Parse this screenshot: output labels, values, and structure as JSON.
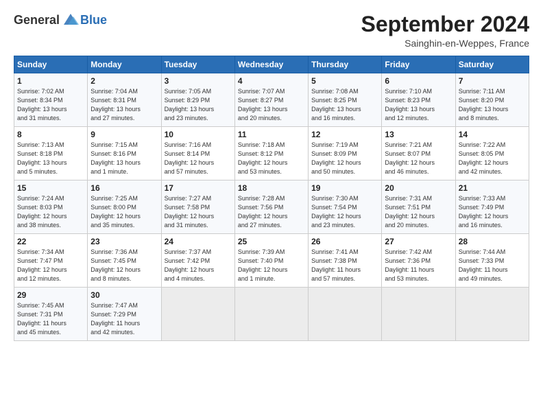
{
  "header": {
    "logo_general": "General",
    "logo_blue": "Blue",
    "month_title": "September 2024",
    "location": "Sainghin-en-Weppes, France"
  },
  "columns": [
    "Sunday",
    "Monday",
    "Tuesday",
    "Wednesday",
    "Thursday",
    "Friday",
    "Saturday"
  ],
  "weeks": [
    [
      {
        "day": "1",
        "info": "Sunrise: 7:02 AM\nSunset: 8:34 PM\nDaylight: 13 hours\nand 31 minutes."
      },
      {
        "day": "2",
        "info": "Sunrise: 7:04 AM\nSunset: 8:31 PM\nDaylight: 13 hours\nand 27 minutes."
      },
      {
        "day": "3",
        "info": "Sunrise: 7:05 AM\nSunset: 8:29 PM\nDaylight: 13 hours\nand 23 minutes."
      },
      {
        "day": "4",
        "info": "Sunrise: 7:07 AM\nSunset: 8:27 PM\nDaylight: 13 hours\nand 20 minutes."
      },
      {
        "day": "5",
        "info": "Sunrise: 7:08 AM\nSunset: 8:25 PM\nDaylight: 13 hours\nand 16 minutes."
      },
      {
        "day": "6",
        "info": "Sunrise: 7:10 AM\nSunset: 8:23 PM\nDaylight: 13 hours\nand 12 minutes."
      },
      {
        "day": "7",
        "info": "Sunrise: 7:11 AM\nSunset: 8:20 PM\nDaylight: 13 hours\nand 8 minutes."
      }
    ],
    [
      {
        "day": "8",
        "info": "Sunrise: 7:13 AM\nSunset: 8:18 PM\nDaylight: 13 hours\nand 5 minutes."
      },
      {
        "day": "9",
        "info": "Sunrise: 7:15 AM\nSunset: 8:16 PM\nDaylight: 13 hours\nand 1 minute."
      },
      {
        "day": "10",
        "info": "Sunrise: 7:16 AM\nSunset: 8:14 PM\nDaylight: 12 hours\nand 57 minutes."
      },
      {
        "day": "11",
        "info": "Sunrise: 7:18 AM\nSunset: 8:12 PM\nDaylight: 12 hours\nand 53 minutes."
      },
      {
        "day": "12",
        "info": "Sunrise: 7:19 AM\nSunset: 8:09 PM\nDaylight: 12 hours\nand 50 minutes."
      },
      {
        "day": "13",
        "info": "Sunrise: 7:21 AM\nSunset: 8:07 PM\nDaylight: 12 hours\nand 46 minutes."
      },
      {
        "day": "14",
        "info": "Sunrise: 7:22 AM\nSunset: 8:05 PM\nDaylight: 12 hours\nand 42 minutes."
      }
    ],
    [
      {
        "day": "15",
        "info": "Sunrise: 7:24 AM\nSunset: 8:03 PM\nDaylight: 12 hours\nand 38 minutes."
      },
      {
        "day": "16",
        "info": "Sunrise: 7:25 AM\nSunset: 8:00 PM\nDaylight: 12 hours\nand 35 minutes."
      },
      {
        "day": "17",
        "info": "Sunrise: 7:27 AM\nSunset: 7:58 PM\nDaylight: 12 hours\nand 31 minutes."
      },
      {
        "day": "18",
        "info": "Sunrise: 7:28 AM\nSunset: 7:56 PM\nDaylight: 12 hours\nand 27 minutes."
      },
      {
        "day": "19",
        "info": "Sunrise: 7:30 AM\nSunset: 7:54 PM\nDaylight: 12 hours\nand 23 minutes."
      },
      {
        "day": "20",
        "info": "Sunrise: 7:31 AM\nSunset: 7:51 PM\nDaylight: 12 hours\nand 20 minutes."
      },
      {
        "day": "21",
        "info": "Sunrise: 7:33 AM\nSunset: 7:49 PM\nDaylight: 12 hours\nand 16 minutes."
      }
    ],
    [
      {
        "day": "22",
        "info": "Sunrise: 7:34 AM\nSunset: 7:47 PM\nDaylight: 12 hours\nand 12 minutes."
      },
      {
        "day": "23",
        "info": "Sunrise: 7:36 AM\nSunset: 7:45 PM\nDaylight: 12 hours\nand 8 minutes."
      },
      {
        "day": "24",
        "info": "Sunrise: 7:37 AM\nSunset: 7:42 PM\nDaylight: 12 hours\nand 4 minutes."
      },
      {
        "day": "25",
        "info": "Sunrise: 7:39 AM\nSunset: 7:40 PM\nDaylight: 12 hours\nand 1 minute."
      },
      {
        "day": "26",
        "info": "Sunrise: 7:41 AM\nSunset: 7:38 PM\nDaylight: 11 hours\nand 57 minutes."
      },
      {
        "day": "27",
        "info": "Sunrise: 7:42 AM\nSunset: 7:36 PM\nDaylight: 11 hours\nand 53 minutes."
      },
      {
        "day": "28",
        "info": "Sunrise: 7:44 AM\nSunset: 7:33 PM\nDaylight: 11 hours\nand 49 minutes."
      }
    ],
    [
      {
        "day": "29",
        "info": "Sunrise: 7:45 AM\nSunset: 7:31 PM\nDaylight: 11 hours\nand 45 minutes."
      },
      {
        "day": "30",
        "info": "Sunrise: 7:47 AM\nSunset: 7:29 PM\nDaylight: 11 hours\nand 42 minutes."
      },
      {
        "day": "",
        "info": ""
      },
      {
        "day": "",
        "info": ""
      },
      {
        "day": "",
        "info": ""
      },
      {
        "day": "",
        "info": ""
      },
      {
        "day": "",
        "info": ""
      }
    ]
  ]
}
